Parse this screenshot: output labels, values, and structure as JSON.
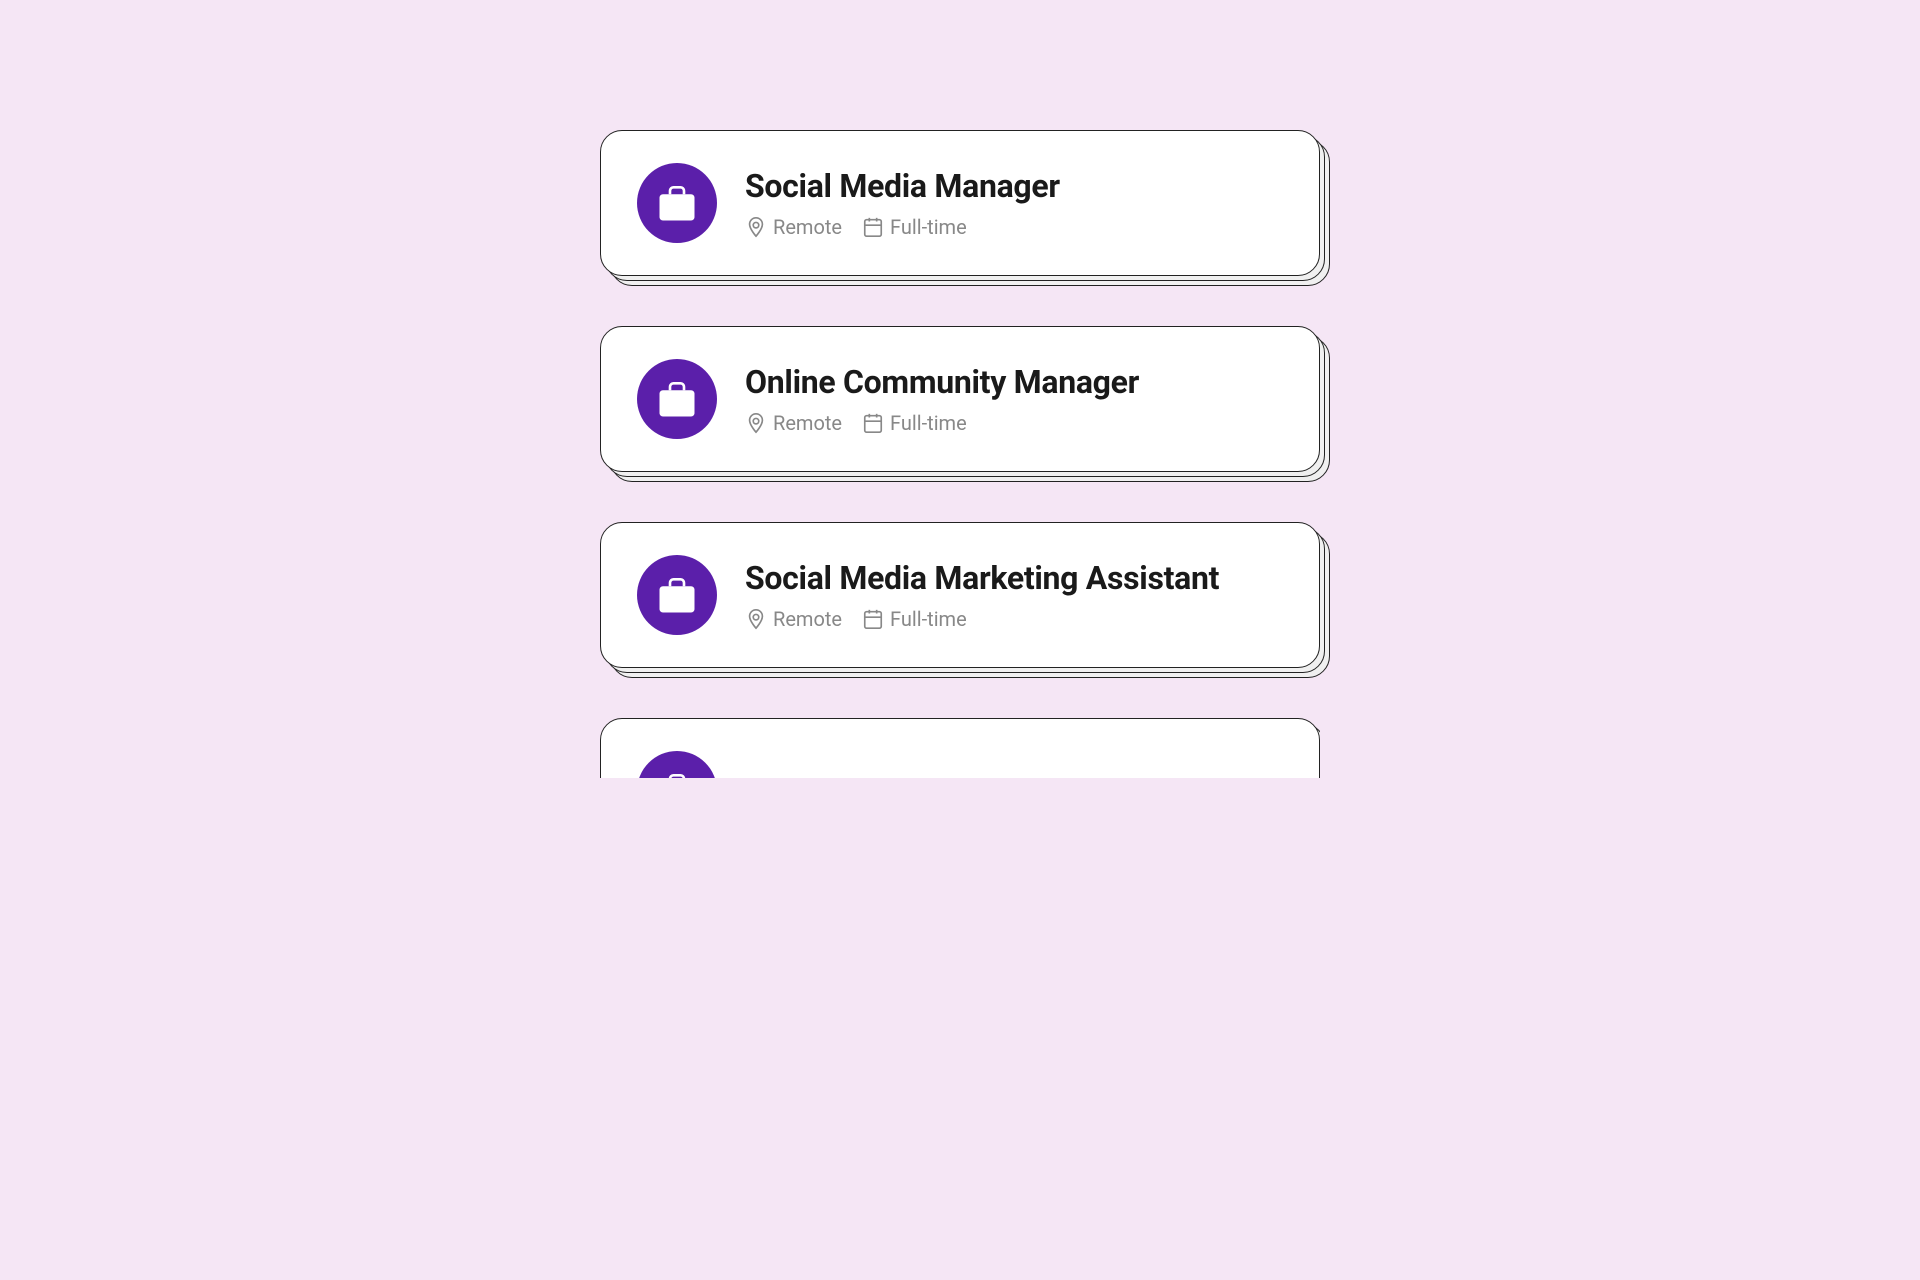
{
  "background_color": "#f5e6f5",
  "jobs": [
    {
      "id": "job-1",
      "title": "Social Media Manager",
      "location": "Remote",
      "employment_type": "Full-time",
      "icon": "briefcase"
    },
    {
      "id": "job-2",
      "title": "Online Community Manager",
      "location": "Remote",
      "employment_type": "Full-time",
      "icon": "briefcase"
    },
    {
      "id": "job-3",
      "title": "Social Media Marketing Assistant",
      "location": "Remote",
      "employment_type": "Full-time",
      "icon": "briefcase"
    },
    {
      "id": "job-4",
      "title": "",
      "location": "",
      "employment_type": "",
      "icon": "briefcase",
      "partial": true
    }
  ],
  "icon_colors": {
    "purple": "#5b1faa"
  }
}
